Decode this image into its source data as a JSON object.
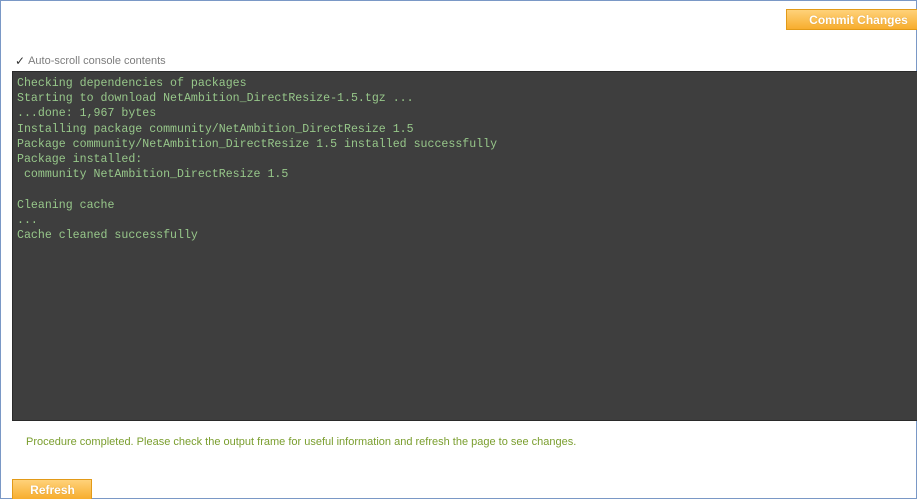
{
  "toolbar": {
    "commit_label": "Commit Changes"
  },
  "autoscroll": {
    "checked": true,
    "label": "Auto-scroll console contents"
  },
  "console": {
    "lines": [
      "Checking dependencies of packages",
      "Starting to download NetAmbition_DirectResize-1.5.tgz ...",
      "...done: 1,967 bytes",
      "Installing package community/NetAmbition_DirectResize 1.5",
      "Package community/NetAmbition_DirectResize 1.5 installed successfully",
      "Package installed:",
      " community NetAmbition_DirectResize 1.5",
      "",
      "Cleaning cache",
      "...",
      "Cache cleaned successfully"
    ]
  },
  "status": {
    "message": "Procedure completed. Please check the output frame for useful information and refresh the page to see changes."
  },
  "actions": {
    "refresh_label": "Refresh"
  },
  "colors": {
    "console_bg": "#3e3e3e",
    "console_text": "#97c78a",
    "button": "#f7ad2e",
    "status_text": "#7a9e2e"
  }
}
